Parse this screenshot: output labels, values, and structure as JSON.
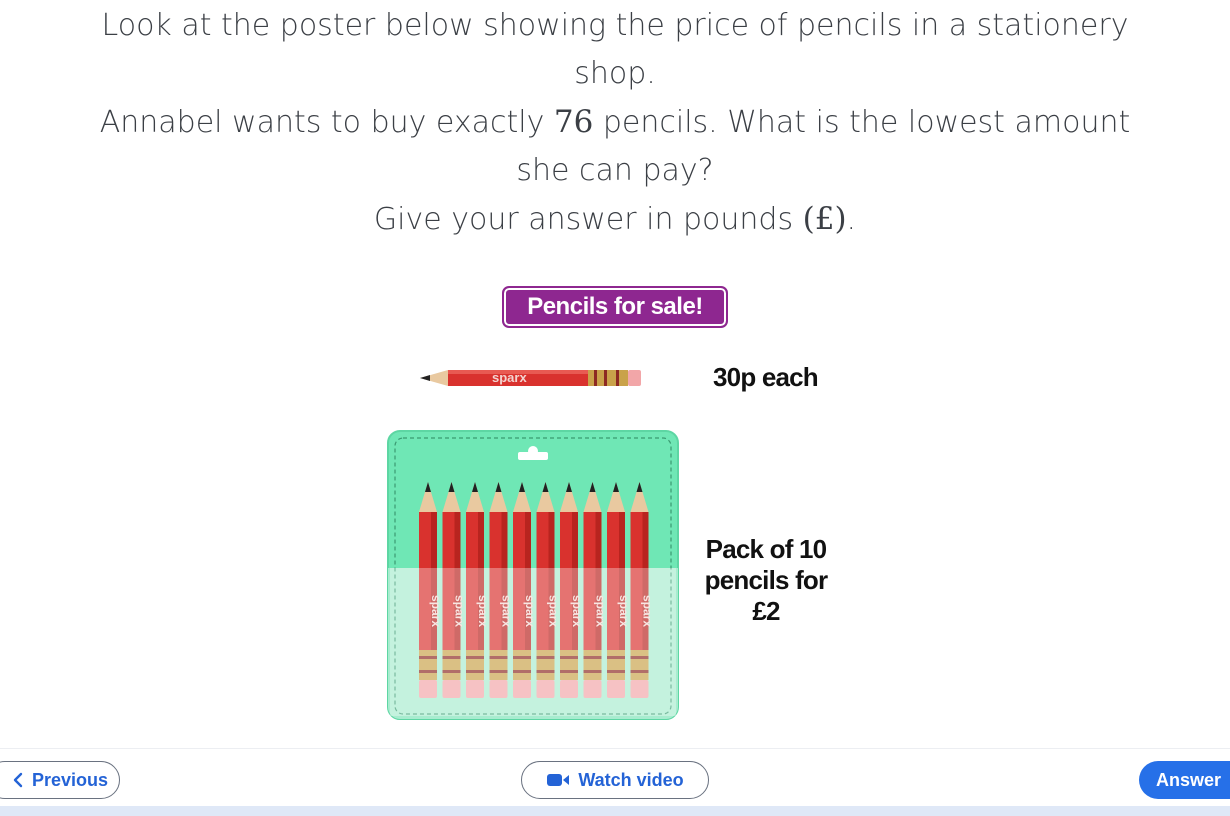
{
  "question": {
    "line1": "Look at the poster below showing the price of pencils in a stationery",
    "line2": "shop.",
    "line3_pre": "Annabel wants to buy exactly ",
    "line3_num": "76",
    "line3_post": " pencils. What is the lowest amount",
    "line4": "she can pay?",
    "line5_pre": "Give your answer in pounds ",
    "line5_sym": "(£)",
    "line5_post": "."
  },
  "poster": {
    "title": "Pencils for sale!",
    "pencil_brand": "sparx",
    "single_price": "30p each",
    "pack_line1": "Pack of 10",
    "pack_line2": "pencils for £2",
    "pack_count": 10
  },
  "footer": {
    "previous_label": "Previous",
    "video_label": "Watch video",
    "answer_label": "Answer"
  },
  "colors": {
    "accent_blue": "#2463d6",
    "poster_purple": "#8e2790",
    "pencil_red": "#d9322e",
    "pack_green": "#6fe7b5"
  },
  "icons": {
    "previous": "chevron-left-icon",
    "video": "video-camera-icon"
  }
}
